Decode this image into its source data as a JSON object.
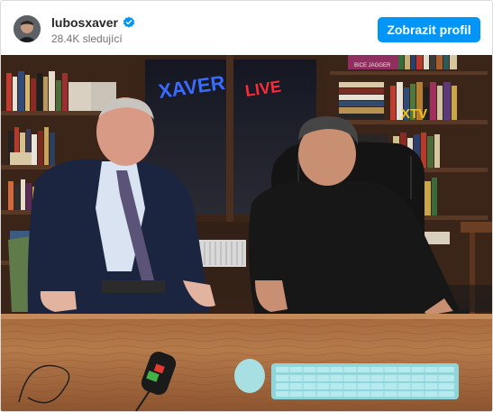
{
  "profile": {
    "username": "lubosxaver",
    "followers": "28.4K sledující",
    "verified": true,
    "avatar_icon": "profile-avatar"
  },
  "actions": {
    "view_profile": "Zobrazit profil"
  },
  "photo": {
    "neon_sign_1": "XAVER",
    "neon_sign_2": "LIVE",
    "shelf_sign": "XTV",
    "book_label": "BICE JAGGER"
  },
  "colors": {
    "accent": "#0095f6",
    "verified": "#0095f6",
    "neon_blue": "#3a6bff",
    "neon_red": "#ff2a3a",
    "neon_yellow": "#f2c21b"
  }
}
